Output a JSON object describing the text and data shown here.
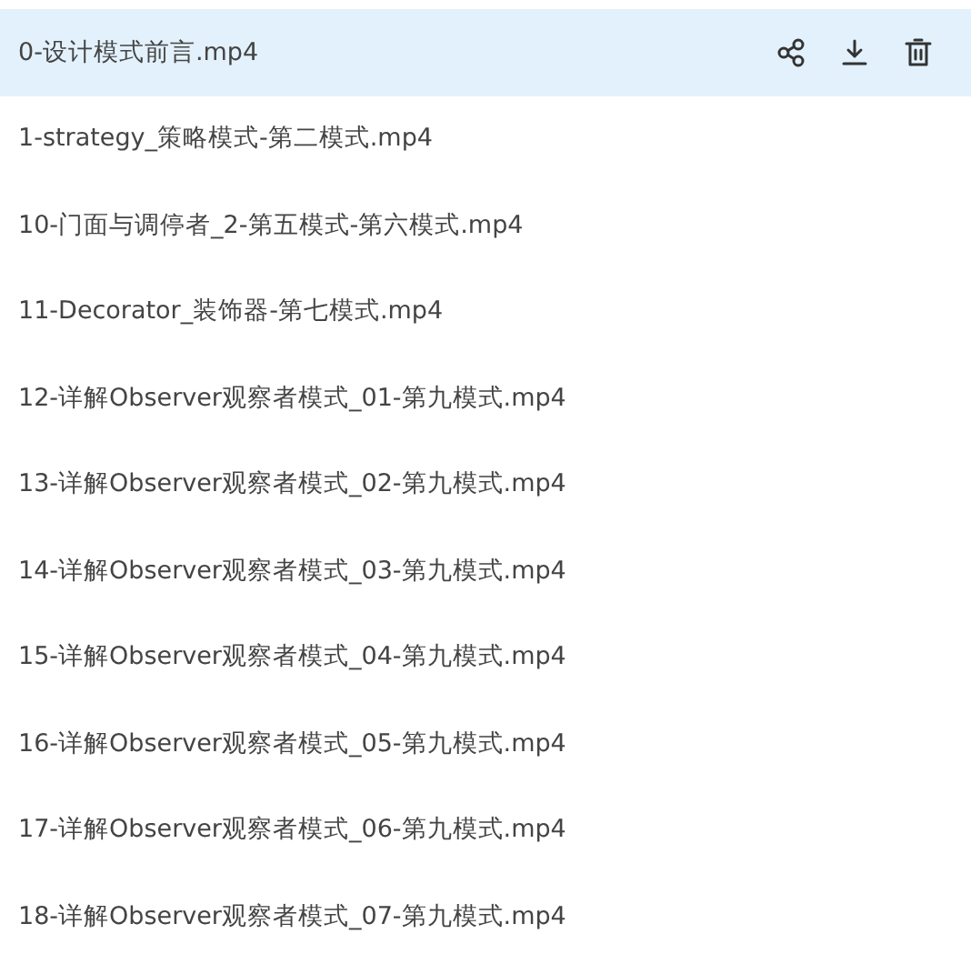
{
  "files": [
    {
      "name": "0-设计模式前言.mp4",
      "selected": true
    },
    {
      "name": "1-strategy_策略模式-第二模式.mp4",
      "selected": false
    },
    {
      "name": "10-门面与调停者_2-第五模式-第六模式.mp4",
      "selected": false
    },
    {
      "name": "11-Decorator_装饰器-第七模式.mp4",
      "selected": false
    },
    {
      "name": "12-详解Observer观察者模式_01-第九模式.mp4",
      "selected": false
    },
    {
      "name": "13-详解Observer观察者模式_02-第九模式.mp4",
      "selected": false
    },
    {
      "name": "14-详解Observer观察者模式_03-第九模式.mp4",
      "selected": false
    },
    {
      "name": "15-详解Observer观察者模式_04-第九模式.mp4",
      "selected": false
    },
    {
      "name": "16-详解Observer观察者模式_05-第九模式.mp4",
      "selected": false
    },
    {
      "name": "17-详解Observer观察者模式_06-第九模式.mp4",
      "selected": false
    },
    {
      "name": "18-详解Observer观察者模式_07-第九模式.mp4",
      "selected": false
    }
  ]
}
